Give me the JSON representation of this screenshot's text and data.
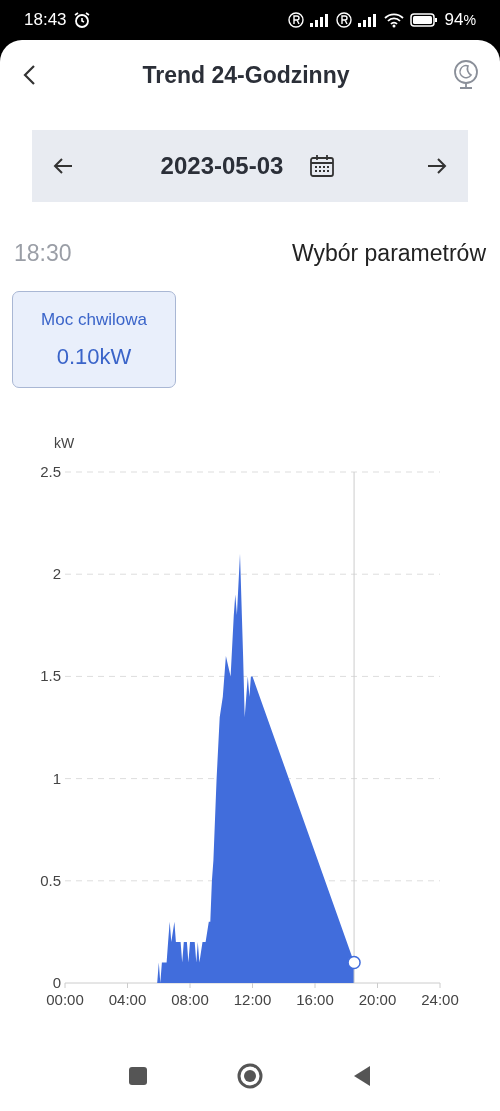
{
  "status_bar": {
    "time": "18:43",
    "battery": "94",
    "battery_unit": "%"
  },
  "header": {
    "title": "Trend 24-Godzinny"
  },
  "date_bar": {
    "date": "2023-05-03"
  },
  "selection": {
    "time": "18:30",
    "parameters_link": "Wybór parametrów"
  },
  "metrics": [
    {
      "label": "Moc chwilowa",
      "value": "0.10kW",
      "selected": true
    }
  ],
  "chart_data": {
    "type": "area",
    "ylabel": "kW",
    "xlim": [
      0,
      24
    ],
    "ylim": [
      0,
      2.5
    ],
    "xticks": [
      {
        "value": 0,
        "label": "00:00"
      },
      {
        "value": 4,
        "label": "04:00"
      },
      {
        "value": 8,
        "label": "08:00"
      },
      {
        "value": 12,
        "label": "12:00"
      },
      {
        "value": 16,
        "label": "16:00"
      },
      {
        "value": 20,
        "label": "20:00"
      },
      {
        "value": 24,
        "label": "24:00"
      }
    ],
    "yticks": [
      {
        "value": 0,
        "label": "0"
      },
      {
        "value": 0.5,
        "label": "0.5"
      },
      {
        "value": 1,
        "label": "1"
      },
      {
        "value": 1.5,
        "label": "1.5"
      },
      {
        "value": 2,
        "label": "2"
      },
      {
        "value": 2.5,
        "label": "2.5"
      }
    ],
    "x": [
      5.5,
      5.9,
      6.0,
      6.1,
      6.2,
      6.5,
      6.6,
      6.7,
      6.8,
      7.0,
      7.1,
      7.4,
      7.5,
      7.6,
      7.8,
      7.9,
      8.0,
      8.3,
      8.4,
      8.5,
      8.6,
      8.8,
      9.0,
      9.2,
      9.3,
      9.4,
      9.5,
      9.7,
      9.9,
      10.1,
      10.3,
      10.6,
      10.8,
      10.9,
      11.0,
      11.2,
      11.4,
      11.5,
      11.7,
      11.8,
      11.9,
      12.0,
      18.5
    ],
    "series": [
      {
        "color": "#416ddc",
        "values": [
          0,
          0,
          0.1,
          0,
          0.1,
          0.1,
          0.2,
          0.3,
          0.2,
          0.3,
          0.2,
          0.2,
          0.1,
          0.2,
          0.2,
          0.1,
          0.2,
          0.2,
          0.1,
          0.2,
          0.1,
          0.2,
          0.2,
          0.3,
          0.3,
          0.5,
          0.6,
          1.0,
          1.3,
          1.4,
          1.6,
          1.5,
          1.8,
          1.9,
          1.8,
          2.1,
          1.6,
          1.3,
          1.5,
          1.4,
          1.5,
          1.5,
          0.1
        ]
      }
    ],
    "grid": true,
    "ref_lines": [
      {
        "axis": "x",
        "value": 18.5
      }
    ]
  }
}
